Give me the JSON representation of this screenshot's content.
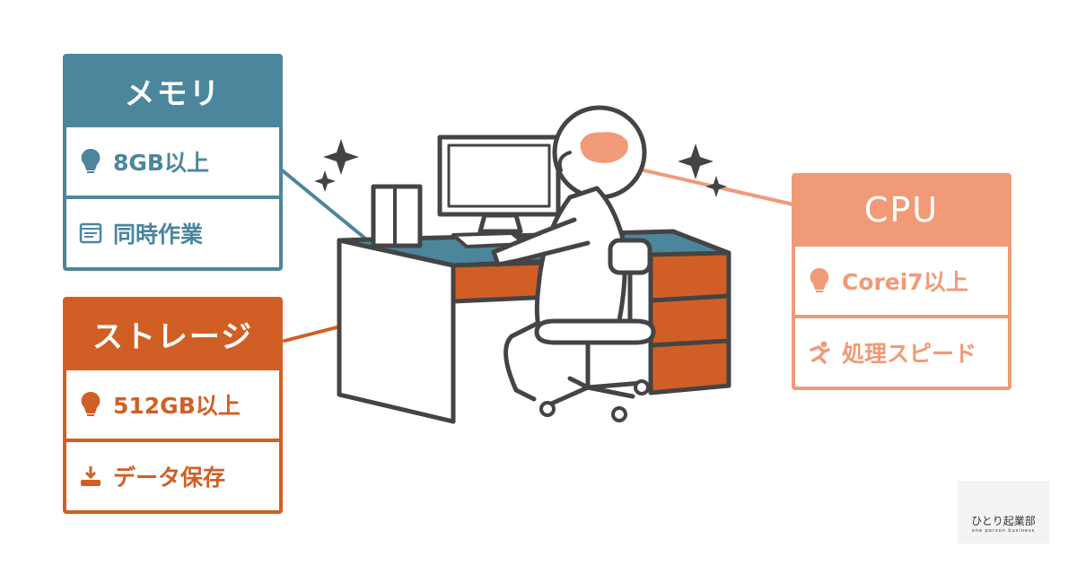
{
  "colors": {
    "memory": "#4b869c",
    "storage": "#d15f25",
    "cpu": "#f09a77",
    "outline": "#444444"
  },
  "memory": {
    "title": "メモリ",
    "rows": [
      {
        "icon": "lightbulb-icon",
        "text": "8GB以上"
      },
      {
        "icon": "window-icon",
        "text": "同時作業"
      }
    ]
  },
  "storage": {
    "title": "ストレージ",
    "rows": [
      {
        "icon": "lightbulb-icon",
        "text": "512GB以上"
      },
      {
        "icon": "download-icon",
        "text": "データ保存"
      }
    ]
  },
  "cpu": {
    "title": "CPU",
    "rows": [
      {
        "icon": "lightbulb-icon",
        "text": "Corei7以上"
      },
      {
        "icon": "running-icon",
        "text": "処理スピード"
      }
    ]
  },
  "logo": {
    "name": "ひとり起業部",
    "tagline": "one person business"
  }
}
